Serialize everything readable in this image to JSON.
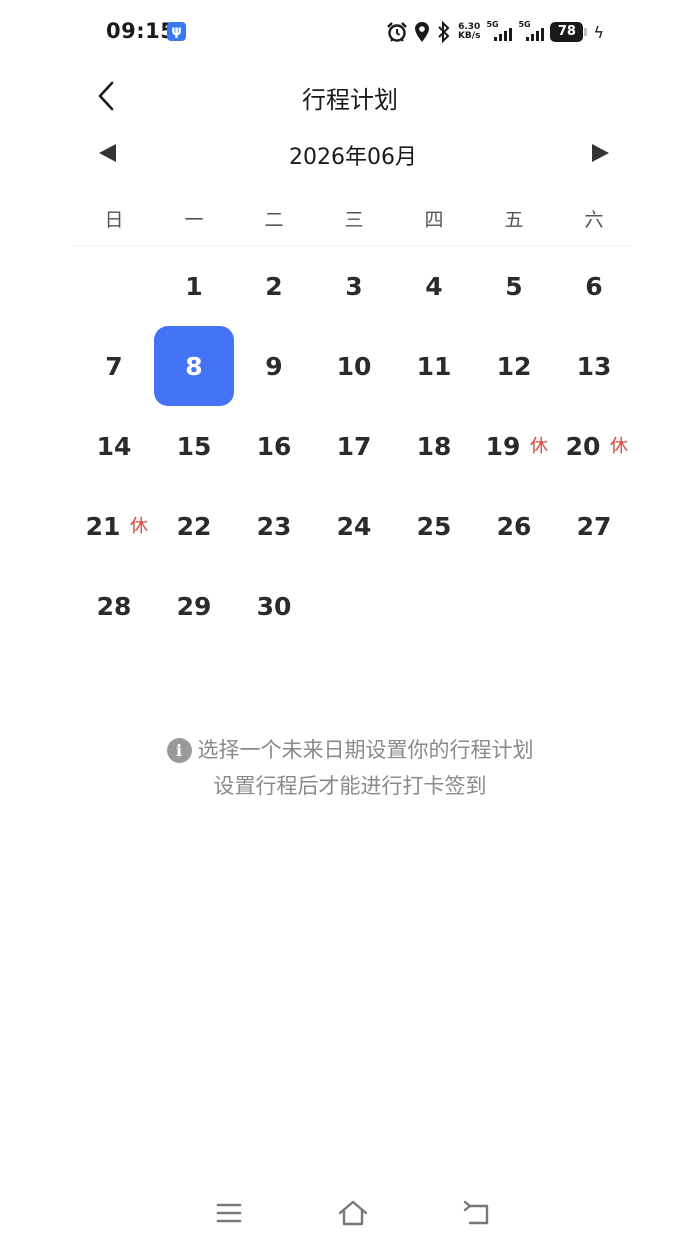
{
  "status_bar": {
    "time": "09:15",
    "usb_icon": "usb-icon",
    "net_speed_value": "6.30",
    "net_speed_unit": "KB/s",
    "sim1_label": "5G",
    "sim2_label": "5G",
    "battery_level": "78"
  },
  "header": {
    "title": "行程计划"
  },
  "calendar": {
    "month_label": "2026年06月",
    "weekdays": [
      "日",
      "一",
      "二",
      "三",
      "四",
      "五",
      "六"
    ],
    "selected_day": 8,
    "days": [
      {
        "num": "",
        "tag": ""
      },
      {
        "num": "1",
        "tag": ""
      },
      {
        "num": "2",
        "tag": ""
      },
      {
        "num": "3",
        "tag": ""
      },
      {
        "num": "4",
        "tag": ""
      },
      {
        "num": "5",
        "tag": ""
      },
      {
        "num": "6",
        "tag": ""
      },
      {
        "num": "7",
        "tag": ""
      },
      {
        "num": "8",
        "tag": ""
      },
      {
        "num": "9",
        "tag": ""
      },
      {
        "num": "10",
        "tag": ""
      },
      {
        "num": "11",
        "tag": ""
      },
      {
        "num": "12",
        "tag": ""
      },
      {
        "num": "13",
        "tag": ""
      },
      {
        "num": "14",
        "tag": ""
      },
      {
        "num": "15",
        "tag": ""
      },
      {
        "num": "16",
        "tag": ""
      },
      {
        "num": "17",
        "tag": ""
      },
      {
        "num": "18",
        "tag": ""
      },
      {
        "num": "19",
        "tag": "休"
      },
      {
        "num": "20",
        "tag": "休"
      },
      {
        "num": "21",
        "tag": "休"
      },
      {
        "num": "22",
        "tag": ""
      },
      {
        "num": "23",
        "tag": ""
      },
      {
        "num": "24",
        "tag": ""
      },
      {
        "num": "25",
        "tag": ""
      },
      {
        "num": "26",
        "tag": ""
      },
      {
        "num": "27",
        "tag": ""
      },
      {
        "num": "28",
        "tag": ""
      },
      {
        "num": "29",
        "tag": ""
      },
      {
        "num": "30",
        "tag": ""
      }
    ]
  },
  "hint": {
    "line1": "选择一个未来日期设置你的行程计划",
    "line2": "设置行程后才能进行打卡签到",
    "icon": "info-icon",
    "icon_glyph": "i"
  },
  "colors": {
    "accent": "#4573f5",
    "holiday": "#d9453b",
    "hint_text": "#8a8a8a"
  }
}
